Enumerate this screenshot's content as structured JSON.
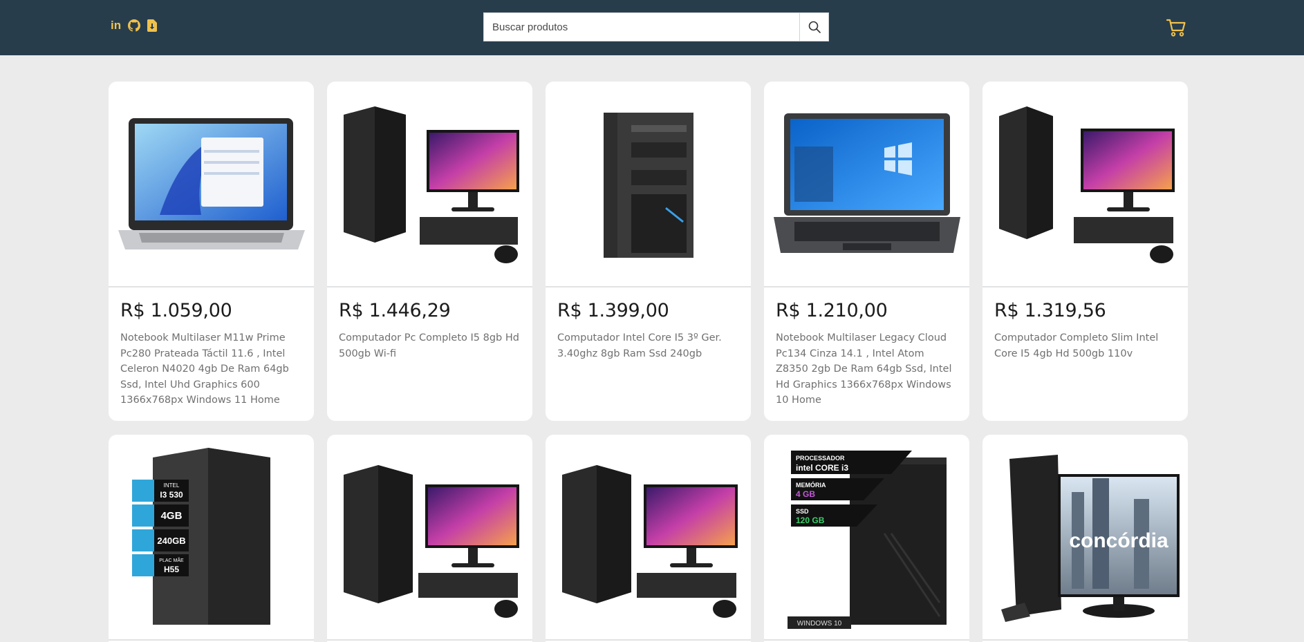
{
  "header": {
    "social_icons": [
      "linkedin-icon",
      "github-icon",
      "resume-download-icon"
    ],
    "linkedin_label": "in",
    "search_placeholder": "Buscar produtos",
    "search_icon": "search-icon",
    "cart_icon": "cart-icon"
  },
  "colors": {
    "header_bg": "#283d4c",
    "accent": "#f0c24b",
    "page_bg": "#ebebec"
  },
  "products": [
    {
      "price": "R$ 1.059,00",
      "title": "Notebook Multilaser M11w Prime Pc280 Prateada Táctil 11.6 , Intel Celeron N4020 4gb De Ram 64gb Ssd, Intel Uhd Graphics 600 1366x768px Windows 11 Home",
      "image": "silver-laptop"
    },
    {
      "price": "R$ 1.446,29",
      "title": "Computador Pc Completo I5 8gb Hd 500gb Wi-fi",
      "image": "desktop-kit"
    },
    {
      "price": "R$ 1.399,00",
      "title": "Computador Intel Core I5 3º Ger. 3.40ghz 8gb Ram Ssd 240gb",
      "image": "desktop-tower"
    },
    {
      "price": "R$ 1.210,00",
      "title": "Notebook Multilaser Legacy Cloud Pc134 Cinza 14.1 , Intel Atom Z8350 2gb De Ram 64gb Ssd, Intel Hd Graphics 1366x768px Windows 10 Home",
      "image": "grey-laptop"
    },
    {
      "price": "R$ 1.319,56",
      "title": "Computador Completo Slim Intel Core I5 4gb Hd 500gb 110v",
      "image": "slim-desktop-kit"
    },
    {
      "price": "",
      "title": "",
      "image": "tower-with-spec-badges",
      "badges": [
        [
          "INTEL",
          "I3 530"
        ],
        [
          "",
          "4GB"
        ],
        [
          "",
          "240GB"
        ],
        [
          "PLAC MÃE",
          "H55"
        ]
      ]
    },
    {
      "price": "",
      "title": "",
      "image": "desktop-kit"
    },
    {
      "price": "",
      "title": "",
      "image": "desktop-kit"
    },
    {
      "price": "",
      "title": "",
      "image": "tower-processor-banner",
      "banners": [
        [
          "PROCESSADOR",
          "intel CORE i3"
        ],
        [
          "MEMÓRIA",
          "4 GB"
        ],
        [
          "SSD",
          "120 GB"
        ]
      ],
      "os_label": "WINDOWS 10"
    },
    {
      "price": "",
      "title": "",
      "image": "concordia-desktop",
      "brand": "concórdia"
    }
  ]
}
